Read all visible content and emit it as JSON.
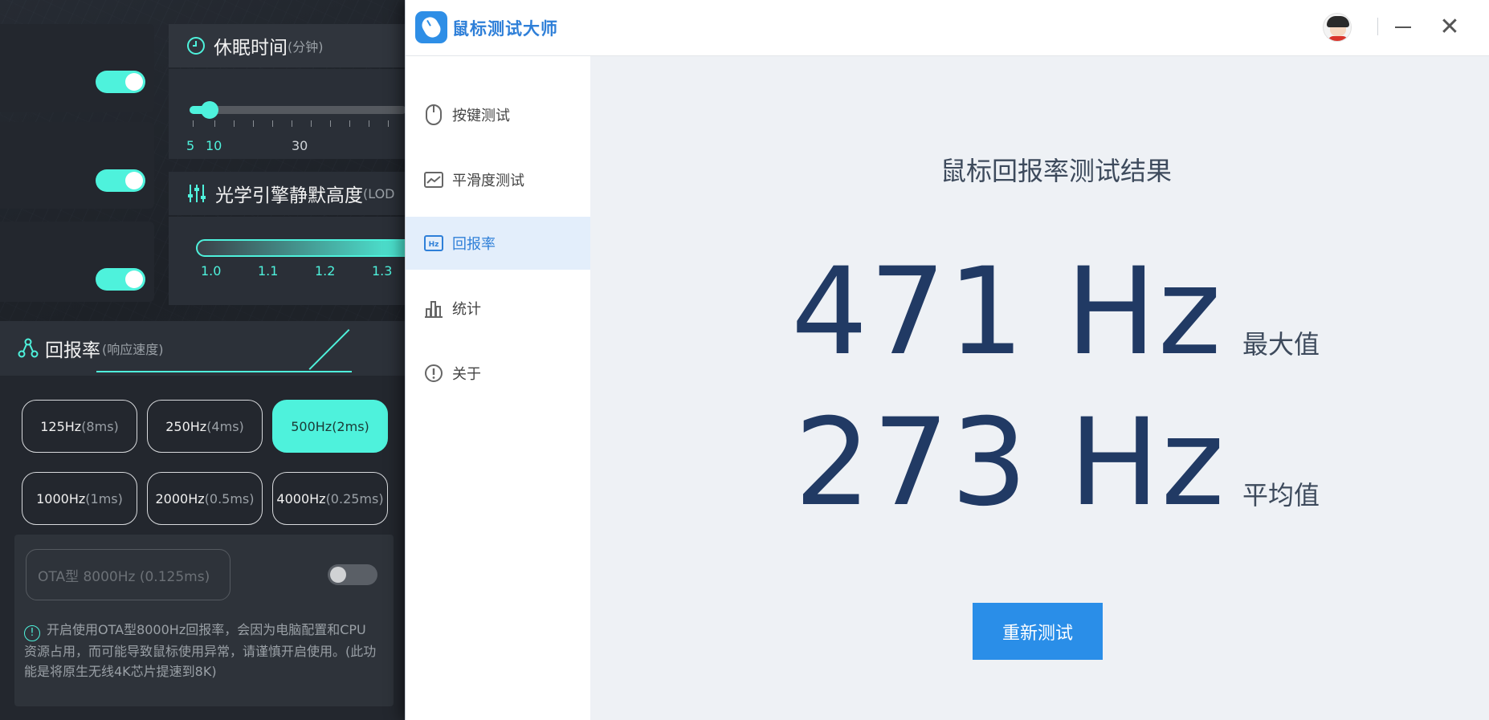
{
  "background_app": {
    "sleep_time": {
      "title": "休眠时间",
      "unit": "(分钟)",
      "ticks": [
        "5",
        "10",
        "30"
      ]
    },
    "lod": {
      "title": "光学引擎静默高度",
      "suffix": "(LOD",
      "ticks": [
        "1.0",
        "1.1",
        "1.2",
        "1.3"
      ]
    },
    "polling": {
      "title": "回报率",
      "subtitle": "(响应速度)",
      "buttons": [
        {
          "hz": "125Hz",
          "ms": "(8ms)",
          "active": false
        },
        {
          "hz": "250Hz",
          "ms": "(4ms)",
          "active": false
        },
        {
          "hz": "500Hz",
          "ms": "(2ms)",
          "active": true
        },
        {
          "hz": "1000Hz",
          "ms": "(1ms)",
          "active": false
        },
        {
          "hz": "2000Hz",
          "ms": "(0.5ms)",
          "active": false
        },
        {
          "hz": "4000Hz",
          "ms": "(0.25ms)",
          "active": false
        }
      ],
      "ota_label": "OTA型 8000Hz (0.125ms)",
      "ota_enabled": false,
      "warning": "开启使用OTA型8000Hz回报率，会因为电脑配置和CPU资源占用，而可能导致鼠标使用异常，请谨慎开启使用。(此功能是将原生无线4K芯片提速到8K)"
    },
    "toggles_on": [
      true,
      true,
      true
    ],
    "accent_color": "#4ef2dc"
  },
  "window": {
    "app_title": "鼠标测试大师",
    "nav": [
      {
        "label": "按键测试",
        "icon": "mouse-icon",
        "active": false
      },
      {
        "label": "平滑度测试",
        "icon": "line-chart-icon",
        "active": false
      },
      {
        "label": "回报率",
        "icon": "hz-icon",
        "active": true
      },
      {
        "label": "统计",
        "icon": "bar-chart-icon",
        "active": false
      },
      {
        "label": "关于",
        "icon": "info-icon",
        "active": false
      }
    ],
    "result": {
      "title": "鼠标回报率测试结果",
      "max_value": "471 Hz",
      "max_label": "最大值",
      "avg_value": "273 Hz",
      "avg_label": "平均值",
      "retest_label": "重新测试"
    },
    "accent_color": "#2a8ee8",
    "value_color": "#213a64"
  }
}
